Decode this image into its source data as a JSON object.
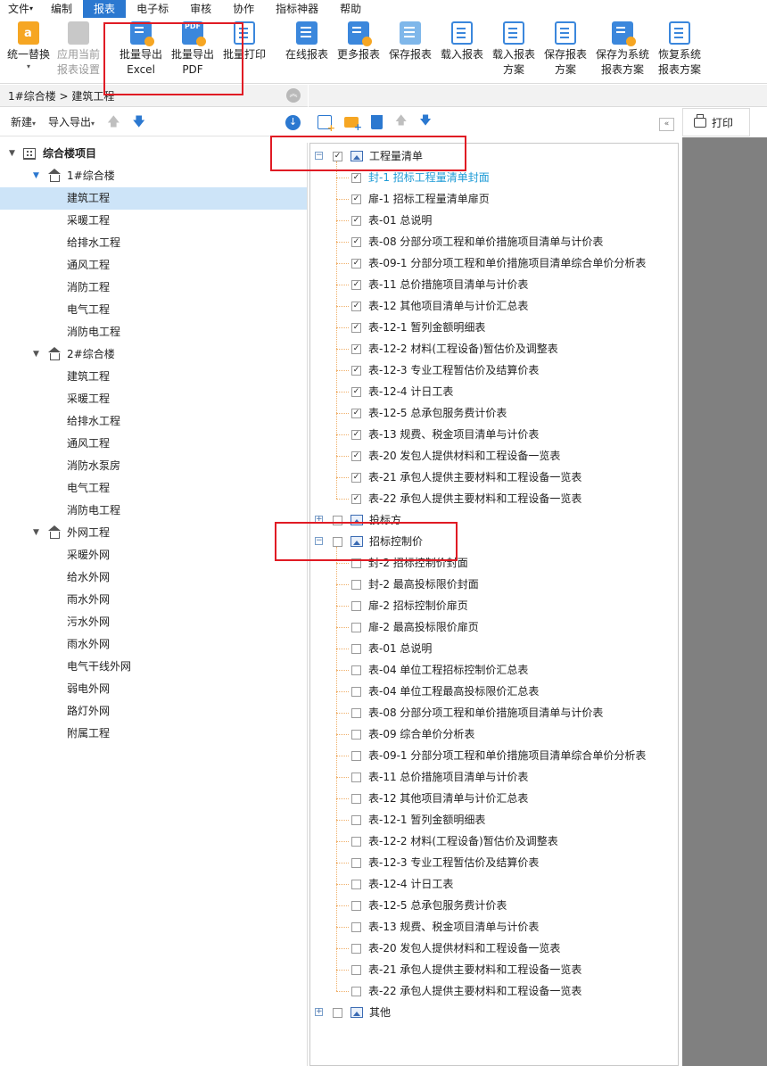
{
  "menu": [
    "文件",
    "编制",
    "报表",
    "电子标",
    "审核",
    "协作",
    "指标神器",
    "帮助"
  ],
  "menu_active": "报表",
  "file_arrow": "▾",
  "ribbon": {
    "unify_replace": {
      "l1": "统一替换",
      "l2": "▾"
    },
    "apply_current": {
      "l1": "应用当前",
      "l2": "报表设置"
    },
    "batch_excel": {
      "l1": "批量导出",
      "l2": "Excel"
    },
    "batch_pdf": {
      "l1": "批量导出",
      "l2": "PDF",
      "icon_text": "PDF"
    },
    "batch_print": {
      "l1": "批量打印"
    },
    "online_report": {
      "l1": "在线报表"
    },
    "more_report": {
      "l1": "更多报表"
    },
    "save_report": {
      "l1": "保存报表"
    },
    "load_report": {
      "l1": "载入报表"
    },
    "load_scheme": {
      "l1": "载入报表",
      "l2": "方案"
    },
    "save_scheme": {
      "l1": "保存报表",
      "l2": "方案"
    },
    "save_system": {
      "l1": "保存为系统",
      "l2": "报表方案"
    },
    "restore_system": {
      "l1": "恢复系统",
      "l2": "报表方案"
    }
  },
  "breadcrumb": "1#综合楼 > 建筑工程",
  "left_toolbar": {
    "new": "新建",
    "import_export": "导入导出"
  },
  "left_tree": [
    {
      "label": "综合楼项目",
      "level": 0,
      "type": "project"
    },
    {
      "label": "1#综合楼",
      "level": 1,
      "type": "building"
    },
    {
      "label": "建筑工程",
      "level": 2,
      "selected": true
    },
    {
      "label": "采暖工程",
      "level": 2
    },
    {
      "label": "给排水工程",
      "level": 2
    },
    {
      "label": "通风工程",
      "level": 2
    },
    {
      "label": "消防工程",
      "level": 2
    },
    {
      "label": "电气工程",
      "level": 2
    },
    {
      "label": "消防电工程",
      "level": 2
    },
    {
      "label": "2#综合楼",
      "level": 1,
      "type": "building"
    },
    {
      "label": "建筑工程",
      "level": 2
    },
    {
      "label": "采暖工程",
      "level": 2
    },
    {
      "label": "给排水工程",
      "level": 2
    },
    {
      "label": "通风工程",
      "level": 2
    },
    {
      "label": "消防水泵房",
      "level": 2
    },
    {
      "label": "电气工程",
      "level": 2
    },
    {
      "label": "消防电工程",
      "level": 2
    },
    {
      "label": "外网工程",
      "level": 1,
      "type": "building"
    },
    {
      "label": "采暖外网",
      "level": 2
    },
    {
      "label": "给水外网",
      "level": 2
    },
    {
      "label": "雨水外网",
      "level": 2
    },
    {
      "label": "污水外网",
      "level": 2
    },
    {
      "label": "雨水外网",
      "level": 2
    },
    {
      "label": "电气干线外网",
      "level": 2
    },
    {
      "label": "弱电外网",
      "level": 2
    },
    {
      "label": "路灯外网",
      "level": 2
    },
    {
      "label": "附属工程",
      "level": 2
    }
  ],
  "groups": [
    {
      "label": "工程量清单",
      "expanded": true,
      "checked": true,
      "items": [
        {
          "label": "封-1 招标工程量清单封面",
          "checked": true,
          "link": true
        },
        {
          "label": "扉-1 招标工程量清单扉页",
          "checked": true
        },
        {
          "label": "表-01 总说明",
          "checked": true
        },
        {
          "label": "表-08 分部分项工程和单价措施项目清单与计价表",
          "checked": true
        },
        {
          "label": "表-09-1 分部分项工程和单价措施项目清单综合单价分析表",
          "checked": true
        },
        {
          "label": "表-11 总价措施项目清单与计价表",
          "checked": true
        },
        {
          "label": "表-12 其他项目清单与计价汇总表",
          "checked": true
        },
        {
          "label": "表-12-1 暂列金额明细表",
          "checked": true
        },
        {
          "label": "表-12-2 材料(工程设备)暂估价及调整表",
          "checked": true
        },
        {
          "label": "表-12-3 专业工程暂估价及结算价表",
          "checked": true
        },
        {
          "label": "表-12-4 计日工表",
          "checked": true
        },
        {
          "label": "表-12-5 总承包服务费计价表",
          "checked": true
        },
        {
          "label": "表-13 规费、税金项目清单与计价表",
          "checked": true
        },
        {
          "label": "表-20 发包人提供材料和工程设备一览表",
          "checked": true
        },
        {
          "label": "表-21 承包人提供主要材料和工程设备一览表",
          "checked": true
        },
        {
          "label": "表-22 承包人提供主要材料和工程设备一览表",
          "checked": true
        }
      ]
    },
    {
      "label": "投标方",
      "expanded": false,
      "checked": false,
      "items": []
    },
    {
      "label": "招标控制价",
      "expanded": true,
      "checked": false,
      "items": [
        {
          "label": "封-2 招标控制价封面",
          "checked": false
        },
        {
          "label": "封-2 最高投标限价封面",
          "checked": false
        },
        {
          "label": "扉-2 招标控制价扉页",
          "checked": false
        },
        {
          "label": "扉-2 最高投标限价扉页",
          "checked": false
        },
        {
          "label": "表-01 总说明",
          "checked": false
        },
        {
          "label": "表-04 单位工程招标控制价汇总表",
          "checked": false
        },
        {
          "label": "表-04 单位工程最高投标限价汇总表",
          "checked": false
        },
        {
          "label": "表-08 分部分项工程和单价措施项目清单与计价表",
          "checked": false
        },
        {
          "label": "表-09 综合单价分析表",
          "checked": false
        },
        {
          "label": "表-09-1 分部分项工程和单价措施项目清单综合单价分析表",
          "checked": false
        },
        {
          "label": "表-11 总价措施项目清单与计价表",
          "checked": false
        },
        {
          "label": "表-12 其他项目清单与计价汇总表",
          "checked": false
        },
        {
          "label": "表-12-1 暂列金额明细表",
          "checked": false
        },
        {
          "label": "表-12-2 材料(工程设备)暂估价及调整表",
          "checked": false
        },
        {
          "label": "表-12-3 专业工程暂估价及结算价表",
          "checked": false
        },
        {
          "label": "表-12-4 计日工表",
          "checked": false
        },
        {
          "label": "表-12-5 总承包服务费计价表",
          "checked": false
        },
        {
          "label": "表-13 规费、税金项目清单与计价表",
          "checked": false
        },
        {
          "label": "表-20 发包人提供材料和工程设备一览表",
          "checked": false
        },
        {
          "label": "表-21 承包人提供主要材料和工程设备一览表",
          "checked": false
        },
        {
          "label": "表-22 承包人提供主要材料和工程设备一览表",
          "checked": false
        }
      ]
    },
    {
      "label": "其他",
      "expanded": false,
      "checked": false,
      "items": []
    }
  ],
  "print_tab": "打印",
  "colors": {
    "accent": "#2b78d0",
    "highlight": "#e01b24",
    "selected_row": "#cde4f8",
    "link": "#1e9bd6"
  }
}
